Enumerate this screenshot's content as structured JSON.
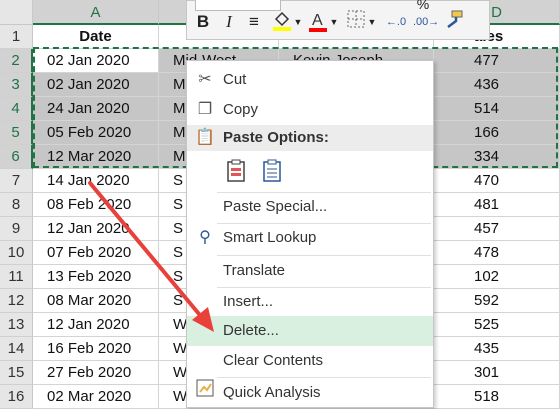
{
  "columns": {
    "a": "A",
    "d": "D"
  },
  "header_row": {
    "num": "1",
    "date": "Date",
    "sales": "ales"
  },
  "rows": [
    {
      "num": "2",
      "date": "02 Jan 2020",
      "region": "Mid-West",
      "name": "Kevin Joseph",
      "sales": "477"
    },
    {
      "num": "3",
      "date": "02 Jan 2020",
      "region": "M",
      "name": "",
      "sales": "436"
    },
    {
      "num": "4",
      "date": "24 Jan 2020",
      "region": "M",
      "name": "",
      "sales": "514"
    },
    {
      "num": "5",
      "date": "05 Feb 2020",
      "region": "M",
      "name": "",
      "sales": "166"
    },
    {
      "num": "6",
      "date": "12 Mar 2020",
      "region": "M",
      "name": "",
      "sales": "334"
    },
    {
      "num": "7",
      "date": "14 Jan 2020",
      "region": "S",
      "name": "",
      "sales": "470"
    },
    {
      "num": "8",
      "date": "08 Feb 2020",
      "region": "S",
      "name": "",
      "sales": "481"
    },
    {
      "num": "9",
      "date": "12 Jan 2020",
      "region": "S",
      "name": "",
      "sales": "457"
    },
    {
      "num": "10",
      "date": "07 Feb 2020",
      "region": "S",
      "name": "",
      "sales": "478"
    },
    {
      "num": "11",
      "date": "13 Feb 2020",
      "region": "S",
      "name": "",
      "sales": "102"
    },
    {
      "num": "12",
      "date": "08 Mar 2020",
      "region": "S",
      "name": "",
      "sales": "592"
    },
    {
      "num": "13",
      "date": "12 Jan 2020",
      "region": "W",
      "name": "",
      "sales": "525"
    },
    {
      "num": "14",
      "date": "16 Feb 2020",
      "region": "W",
      "name": "",
      "sales": "435"
    },
    {
      "num": "15",
      "date": "27 Feb 2020",
      "region": "W",
      "name": "",
      "sales": "301"
    },
    {
      "num": "16",
      "date": "02 Mar 2020",
      "region": "W",
      "name": "",
      "sales": "518"
    }
  ],
  "toolbar": {
    "bold": "B",
    "italic": "I",
    "percent": "%",
    "fill_color": "#ffff00",
    "font_color": "#ff0000"
  },
  "menu": {
    "cut": "Cut",
    "copy": "Copy",
    "paste_options": "Paste Options:",
    "paste_special": "Paste Special...",
    "smart_lookup": "Smart Lookup",
    "translate": "Translate",
    "insert": "Insert...",
    "delete": "Delete...",
    "clear_contents": "Clear Contents",
    "quick_analysis": "Quick Analysis"
  },
  "colors": {
    "accent": "#217346",
    "highlight": "#d9f0e1",
    "arrow": "#e8413b"
  }
}
